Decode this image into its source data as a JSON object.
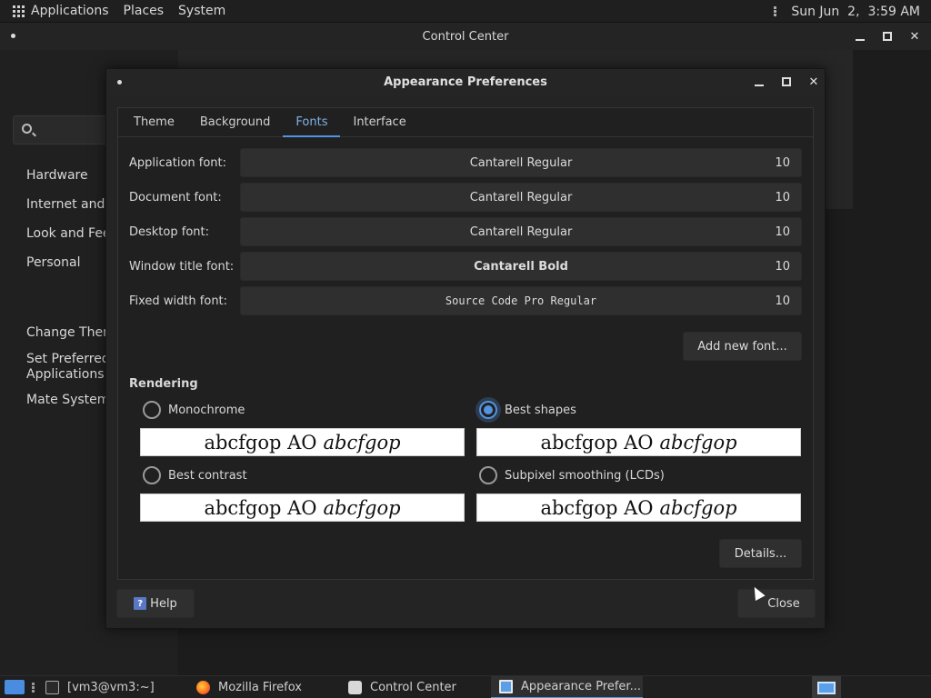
{
  "top_panel": {
    "menus": [
      "Applications",
      "Places",
      "System"
    ],
    "clock": "Sun Jun  2,  3:59 AM"
  },
  "control_center": {
    "title": "Control Center",
    "sidebar_groups": [
      "Hardware",
      "Internet and N",
      "Look and Feel",
      "Personal"
    ],
    "common_tasks": [
      "Change Them",
      "Set Preferred\nApplications",
      "Mate System I"
    ]
  },
  "dialog": {
    "title": "Appearance Preferences",
    "tabs": [
      "Theme",
      "Background",
      "Fonts",
      "Interface"
    ],
    "active_tab": "Fonts",
    "fonts": [
      {
        "label": "Application font:",
        "name": "Cantarell Regular",
        "size": "10"
      },
      {
        "label": "Document font:",
        "name": "Cantarell Regular",
        "size": "10"
      },
      {
        "label": "Desktop font:",
        "name": "Cantarell Regular",
        "size": "10"
      },
      {
        "label": "Window title font:",
        "name": "Cantarell Bold",
        "size": "10"
      },
      {
        "label": "Fixed width font:",
        "name": "Source Code Pro Regular",
        "size": "10"
      }
    ],
    "add_font_button": "Add new font...",
    "rendering_title": "Rendering",
    "rendering_options": [
      {
        "label": "Monochrome",
        "checked": false
      },
      {
        "label": "Best shapes",
        "checked": true
      },
      {
        "label": "Best contrast",
        "checked": false
      },
      {
        "label": "Subpixel smoothing (LCDs)",
        "checked": false
      }
    ],
    "sample_text": "abcfgop AO",
    "sample_text_italic": "abcfgop",
    "details_button": "Details...",
    "help_button": "Help",
    "close_button": "Close"
  },
  "taskbar": {
    "tasks": [
      "[vm3@vm3:~]",
      "Mozilla Firefox",
      "Control Center",
      "Appearance Prefer..."
    ],
    "active_task": "Appearance Prefer..."
  },
  "colors": {
    "accent": "#5294e2",
    "window_bg": "#242424",
    "button_bg": "#2f2f2f"
  }
}
